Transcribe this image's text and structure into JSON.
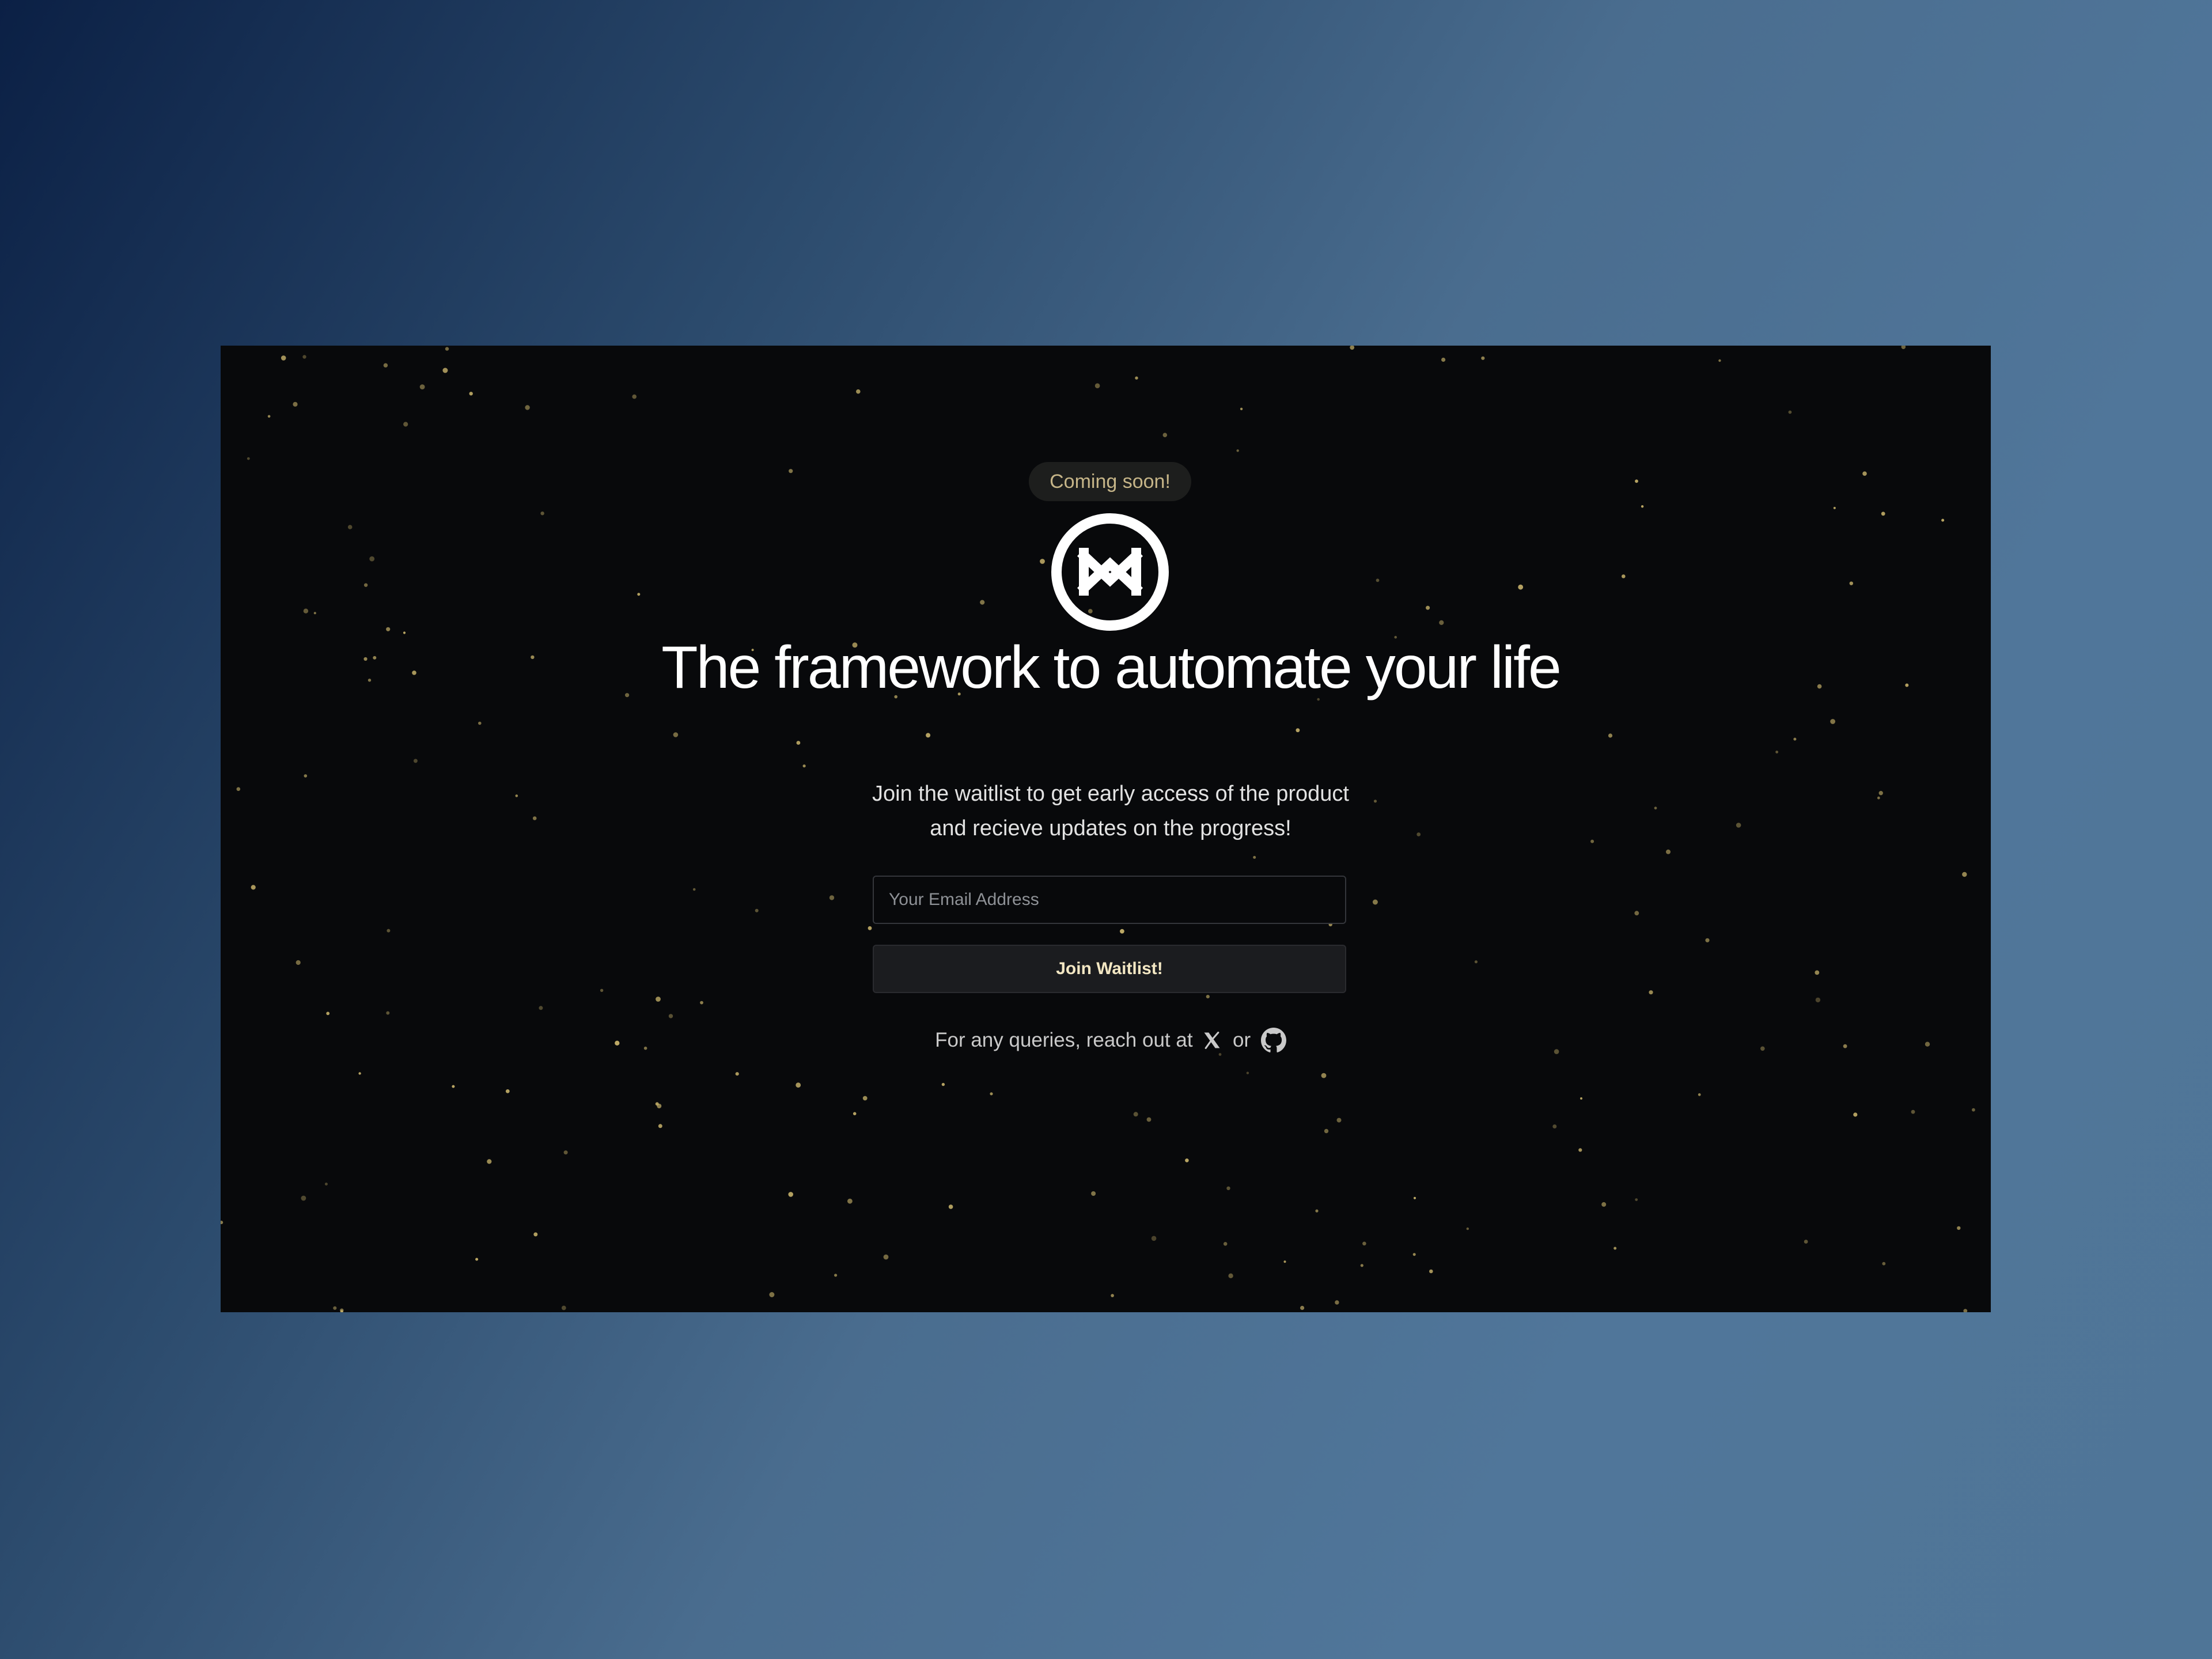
{
  "badge": {
    "text": "Coming soon!"
  },
  "logo": {
    "icon": "automation-logo-icon"
  },
  "hero": {
    "title": "The framework to automate your life",
    "subtitle_line1": "Join the waitlist to get early access of the product",
    "subtitle_line2": "and recieve updates on the progress!"
  },
  "form": {
    "email_placeholder": "Your Email Address",
    "email_value": "",
    "submit_label": "Join Waitlist!"
  },
  "footer": {
    "prefix": "For any queries, reach out at",
    "joiner": "or",
    "links": [
      {
        "icon": "x-logo-icon"
      },
      {
        "icon": "github-icon"
      }
    ]
  },
  "colors": {
    "page_background_start": "#0b2045",
    "page_background_end": "#50769a",
    "panel_background": "#08090b",
    "badge_background": "#1d1e1d",
    "badge_text": "#c6b588",
    "button_text": "#f3e7c3",
    "star": "#c8b36b"
  }
}
